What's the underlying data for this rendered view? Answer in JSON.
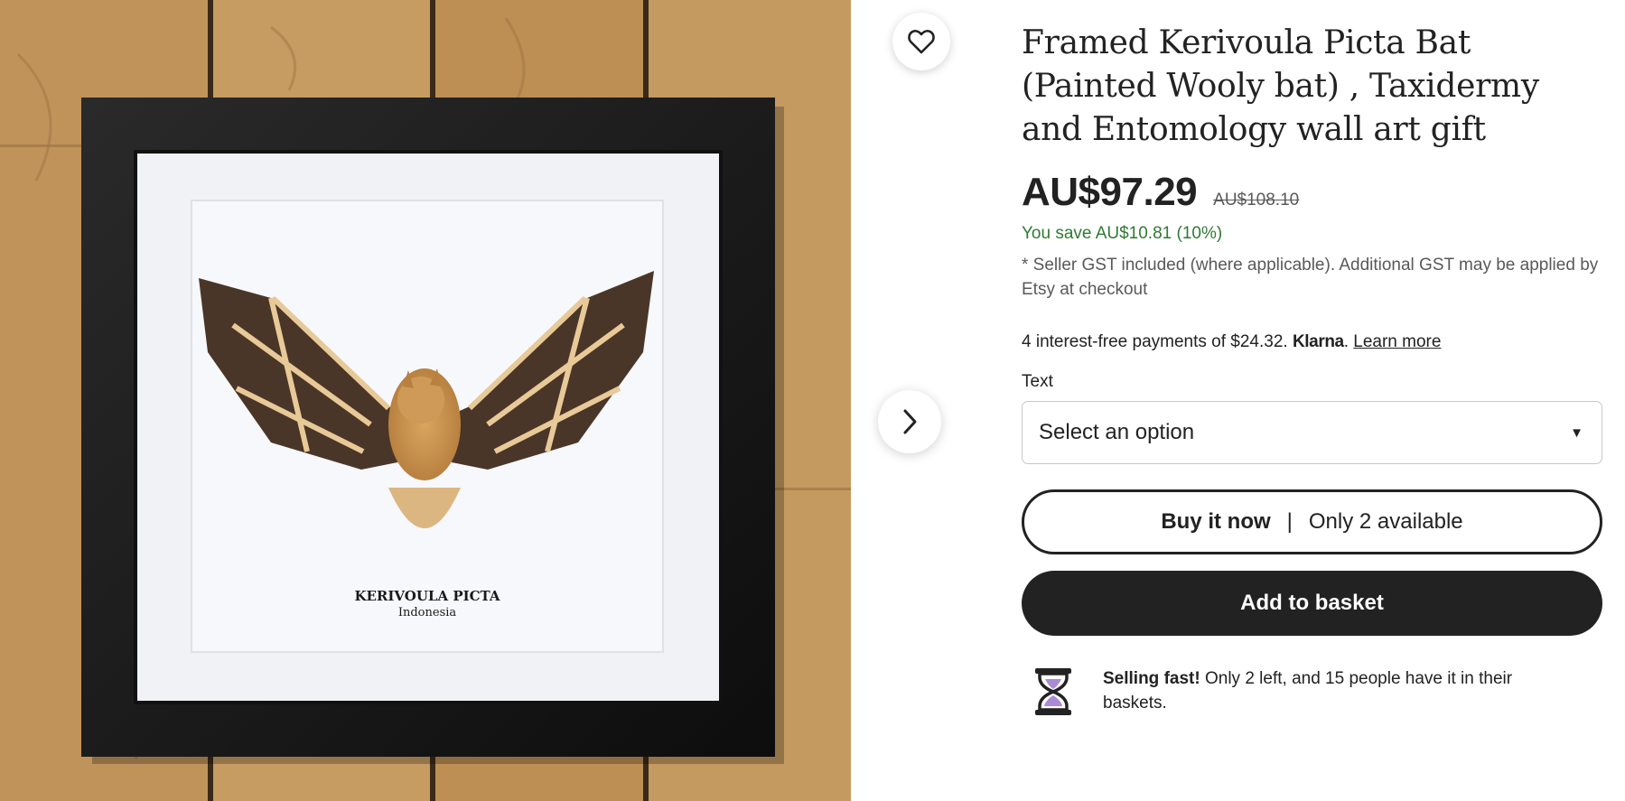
{
  "listing": {
    "title": "Framed Kerivoula Picta Bat (Painted Wooly bat) , Taxidermy and Entomology wall art gift",
    "price": "AU$97.29",
    "original_price": "AU$108.10",
    "savings": "You save AU$10.81 (10%)",
    "gst_note": "* Seller GST included (where applicable). Additional GST may be applied by Etsy at checkout"
  },
  "image": {
    "label_title": "KERIVOULA PICTA",
    "label_subtitle": "Indonesia",
    "favorite_icon": "heart-icon",
    "next_icon": "chevron-right-icon"
  },
  "klarna": {
    "text": "4 interest-free payments of $24.32.",
    "brand": "Klarna",
    "brand_suffix": ".",
    "link": "Learn more"
  },
  "variation": {
    "label": "Text",
    "selected": "Select an option"
  },
  "actions": {
    "buy_now": "Buy it now",
    "separator": "|",
    "availability": "Only 2 available",
    "add_to_basket": "Add to basket"
  },
  "selling_fast": {
    "icon": "hourglass-icon",
    "headline": "Selling fast!",
    "detail": "Only 2 left, and 15 people have it in their baskets."
  },
  "colors": {
    "text": "#222222",
    "muted": "#595959",
    "savings_green": "#2f7a33",
    "button_dark": "#222222",
    "hourglass_purple": "#a98bd6"
  }
}
